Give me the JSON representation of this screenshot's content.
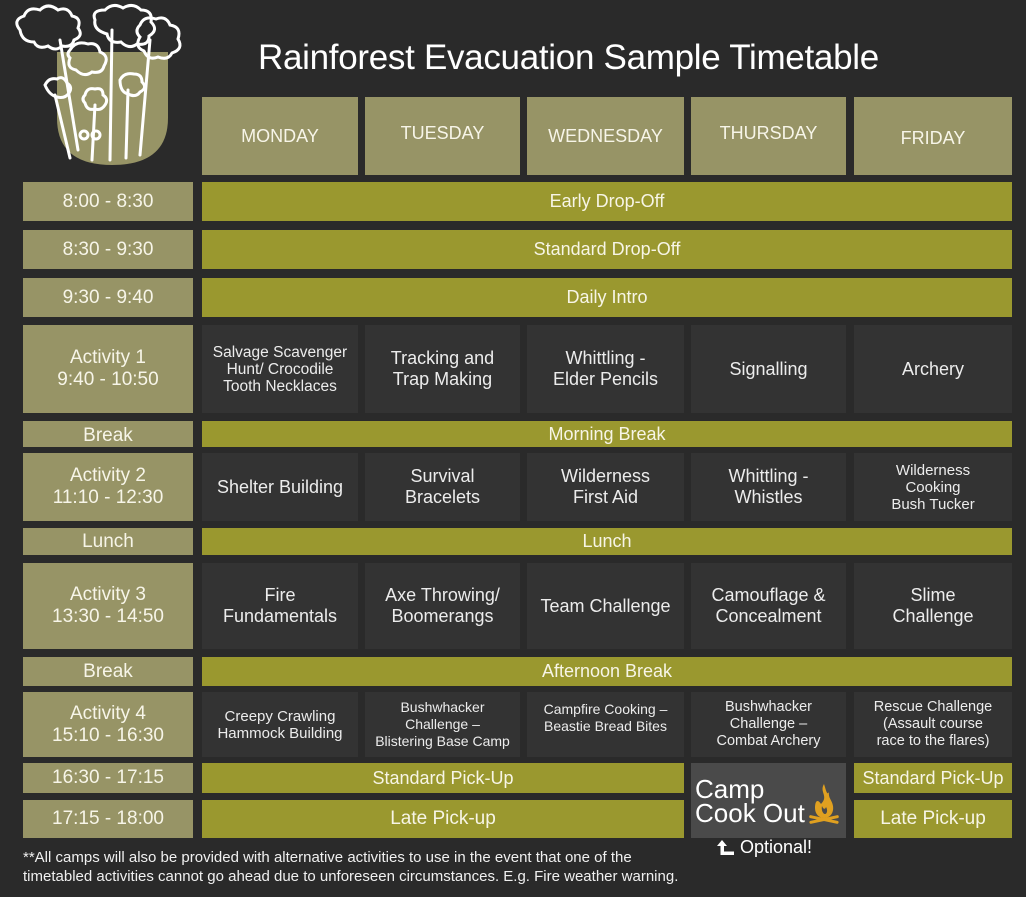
{
  "title": "Rainforest Evacuation Sample Timetable",
  "logo": {
    "icon": "rainforest-trees-logo-icon"
  },
  "colors": {
    "background": "#2a2a2a",
    "header_cell": "#979466",
    "band": "#9a982f",
    "activity_cell": "#333333",
    "cookout_cell": "#4a4a4a",
    "flame": "#e0a020"
  },
  "days": [
    "MONDAY",
    "TUESDAY",
    "WEDNESDAY",
    "THURSDAY",
    "FRIDAY"
  ],
  "rows": [
    {
      "time": "8:00 - 8:30",
      "band": "Early Drop-Off"
    },
    {
      "time": "8:30 - 9:30",
      "band": "Standard Drop-Off"
    },
    {
      "time": "9:30 - 9:40",
      "band": "Daily Intro"
    },
    {
      "time": "Activity 1\n9:40 - 10:50",
      "activities": [
        "Salvage Scavenger\nHunt/ Crocodile\nTooth Necklaces",
        "Tracking and\nTrap Making",
        "Whittling -\nElder Pencils",
        "Signalling",
        "Archery"
      ]
    },
    {
      "time": "Break",
      "band": "Morning Break"
    },
    {
      "time": "Activity 2\n11:10 - 12:30",
      "activities": [
        "Shelter Building",
        "Survival\nBracelets",
        "Wilderness\nFirst Aid",
        "Whittling -\nWhistles",
        "Wilderness\nCooking\nBush Tucker"
      ]
    },
    {
      "time": "Lunch",
      "band": "Lunch"
    },
    {
      "time": "Activity 3\n13:30 - 14:50",
      "activities": [
        "Fire\nFundamentals",
        "Axe Throwing/\nBoomerangs",
        "Team Challenge",
        "Camouflage &\nConcealment",
        "Slime\nChallenge"
      ]
    },
    {
      "time": "Break",
      "band": "Afternoon Break"
    },
    {
      "time": "Activity 4\n15:10 - 16:30",
      "activities": [
        "Creepy Crawling\nHammock Building",
        "Bushwhacker\nChallenge –\nBlistering Base Camp",
        "Campfire Cooking –\nBeastie Bread Bites",
        "Bushwhacker\nChallenge –\nCombat Archery",
        "Rescue Challenge\n(Assault course\nrace to the flares)"
      ]
    },
    {
      "time": "16:30 - 17:15",
      "band_mon_wed": "Standard Pick-Up",
      "band_fri": "Standard Pick-Up"
    },
    {
      "time": "17:15 - 18:00",
      "band_mon_wed": "Late Pick-up",
      "band_fri": "Late Pick-up"
    }
  ],
  "cookout": {
    "label": "Camp\nCook Out",
    "icon": "campfire-icon"
  },
  "optional": {
    "label": "Optional!",
    "icon": "arrow-up-left-icon"
  },
  "footnote": "**All camps will also be provided with alternative activities to use in the event that one of the\ntimetabled activities cannot go ahead due to unforeseen circumstances. E.g. Fire weather warning."
}
